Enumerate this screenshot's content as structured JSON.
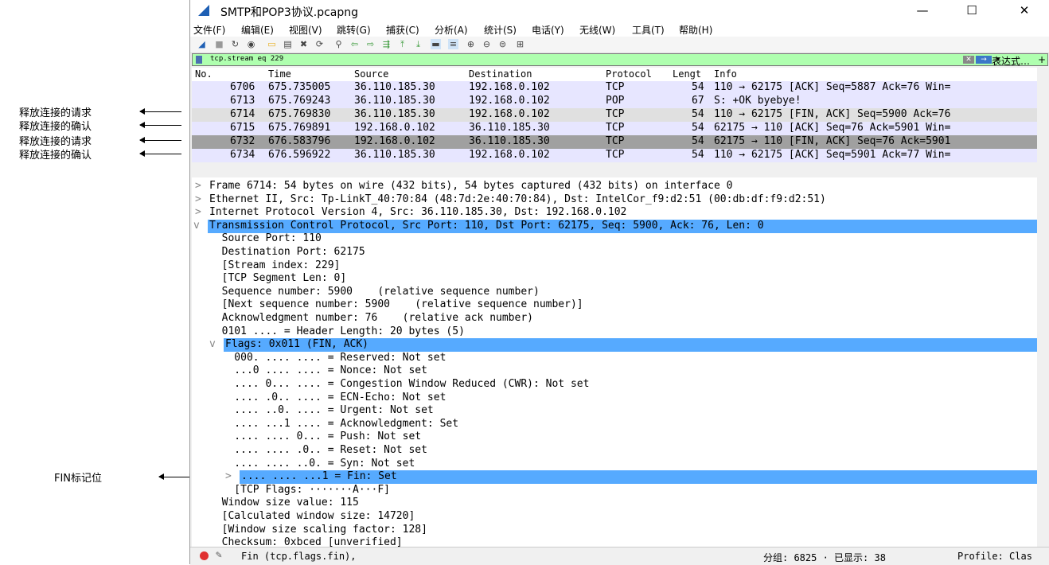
{
  "annotations": {
    "items": [
      "释放连接的请求",
      "释放连接的确认",
      "释放连接的请求",
      "释放连接的确认",
      "FIN标记位"
    ]
  },
  "window": {
    "title": "SMTP和POP3协议.pcapng",
    "minimize": "—",
    "maximize": "☐",
    "close": "✕"
  },
  "menu": [
    "文件(F)",
    "编辑(E)",
    "视图(V)",
    "跳转(G)",
    "捕获(C)",
    "分析(A)",
    "统计(S)",
    "电话(Y)",
    "无线(W)",
    "工具(T)",
    "帮助(H)"
  ],
  "toolbar": {
    "icons": [
      "shark-start-icon",
      "stop-icon",
      "restart-icon",
      "options-icon",
      "open-icon",
      "save-icon",
      "close-file-icon",
      "reload-icon",
      "find-icon",
      "back-icon",
      "forward-icon",
      "goto-icon",
      "first-icon",
      "last-icon",
      "autoscroll-icon",
      "colorize-icon",
      "zoom-in-icon",
      "zoom-out-icon",
      "zoom-reset-icon",
      "resize-columns-icon"
    ],
    "glyphs": [
      "◢",
      "■",
      "↻",
      "◉",
      "▭",
      "▤",
      "✖",
      "⟳",
      "⚲",
      "⇦",
      "⇨",
      "⇶",
      "⤒",
      "⤓",
      "▬",
      "≡",
      "⊕",
      "⊖",
      "⊜",
      "⊞"
    ]
  },
  "filter": {
    "value": "tcp.stream eq 229",
    "expression_label": "表达式…",
    "clear": "✕",
    "apply": "→",
    "dropdown": "▾",
    "add": "+"
  },
  "packet_list": {
    "headers": [
      "No.",
      "Time",
      "Source",
      "Destination",
      "Protocol",
      "Lengt",
      "Info"
    ],
    "rows": [
      {
        "no": "6706",
        "time": "675.735005",
        "src": "36.110.185.30",
        "dst": "192.168.0.102",
        "proto": "TCP",
        "len": "54",
        "info": "110 → 62175 [ACK] Seq=5887 Ack=76 Win=",
        "bg": "#e7e6ff"
      },
      {
        "no": "6713",
        "time": "675.769243",
        "src": "36.110.185.30",
        "dst": "192.168.0.102",
        "proto": "POP",
        "len": "67",
        "info": "S: +OK byebye!",
        "bg": "#e7e6ff"
      },
      {
        "no": "6714",
        "time": "675.769830",
        "src": "36.110.185.30",
        "dst": "192.168.0.102",
        "proto": "TCP",
        "len": "54",
        "info": "110 → 62175 [FIN, ACK] Seq=5900 Ack=76",
        "bg": "#e0e0e0"
      },
      {
        "no": "6715",
        "time": "675.769891",
        "src": "192.168.0.102",
        "dst": "36.110.185.30",
        "proto": "TCP",
        "len": "54",
        "info": "62175 → 110 [ACK] Seq=76 Ack=5901 Win=",
        "bg": "#e7e6ff"
      },
      {
        "no": "6732",
        "time": "676.583796",
        "src": "192.168.0.102",
        "dst": "36.110.185.30",
        "proto": "TCP",
        "len": "54",
        "info": "62175 → 110 [FIN, ACK] Seq=76 Ack=5901",
        "bg": "#a0a0a0"
      },
      {
        "no": "6734",
        "time": "676.596922",
        "src": "36.110.185.30",
        "dst": "192.168.0.102",
        "proto": "TCP",
        "len": "54",
        "info": "110 → 62175 [ACK] Seq=5901 Ack=77 Win=",
        "bg": "#e7e6ff"
      }
    ]
  },
  "detail": {
    "rows": [
      {
        "tw": ">",
        "text": "Frame 6714: 54 bytes on wire (432 bits), 54 bytes captured (432 bits) on interface 0",
        "sel": false
      },
      {
        "tw": ">",
        "text": "Ethernet II, Src: Tp-LinkT_40:70:84 (48:7d:2e:40:70:84), Dst: IntelCor_f9:d2:51 (00:db:df:f9:d2:51)",
        "sel": false
      },
      {
        "tw": ">",
        "text": "Internet Protocol Version 4, Src: 36.110.185.30, Dst: 192.168.0.102",
        "sel": false
      },
      {
        "tw": "v",
        "text": "Transmission Control Protocol, Src Port: 110, Dst Port: 62175, Seq: 5900, Ack: 76, Len: 0",
        "sel": true
      },
      {
        "tw": "",
        "text": "  Source Port: 110",
        "sel": false
      },
      {
        "tw": "",
        "text": "  Destination Port: 62175",
        "sel": false
      },
      {
        "tw": "",
        "text": "  [Stream index: 229]",
        "sel": false
      },
      {
        "tw": "",
        "text": "  [TCP Segment Len: 0]",
        "sel": false
      },
      {
        "tw": "",
        "text": "  Sequence number: 5900    (relative sequence number)",
        "sel": false
      },
      {
        "tw": "",
        "text": "  [Next sequence number: 5900    (relative sequence number)]",
        "sel": false
      },
      {
        "tw": "",
        "text": "  Acknowledgment number: 76    (relative ack number)",
        "sel": false
      },
      {
        "tw": "",
        "text": "  0101 .... = Header Length: 20 bytes (5)",
        "sel": false
      },
      {
        "tw": "v",
        "text": "  Flags: 0x011 (FIN, ACK)",
        "sel": true
      },
      {
        "tw": "",
        "text": "    000. .... .... = Reserved: Not set",
        "sel": false
      },
      {
        "tw": "",
        "text": "    ...0 .... .... = Nonce: Not set",
        "sel": false
      },
      {
        "tw": "",
        "text": "    .... 0... .... = Congestion Window Reduced (CWR): Not set",
        "sel": false
      },
      {
        "tw": "",
        "text": "    .... .0.. .... = ECN-Echo: Not set",
        "sel": false
      },
      {
        "tw": "",
        "text": "    .... ..0. .... = Urgent: Not set",
        "sel": false
      },
      {
        "tw": "",
        "text": "    .... ...1 .... = Acknowledgment: Set",
        "sel": false
      },
      {
        "tw": "",
        "text": "    .... .... 0... = Push: Not set",
        "sel": false
      },
      {
        "tw": "",
        "text": "    .... .... .0.. = Reset: Not set",
        "sel": false
      },
      {
        "tw": "",
        "text": "    .... .... ..0. = Syn: Not set",
        "sel": false
      },
      {
        "tw": ">",
        "text": "    .... .... ...1 = Fin: Set",
        "sel": true
      },
      {
        "tw": "",
        "text": "    [TCP Flags: ·······A···F]",
        "sel": false
      },
      {
        "tw": "",
        "text": "  Window size value: 115",
        "sel": false
      },
      {
        "tw": "",
        "text": "  [Calculated window size: 14720]",
        "sel": false
      },
      {
        "tw": "",
        "text": "  [Window size scaling factor: 128]",
        "sel": false
      },
      {
        "tw": "",
        "text": "  Checksum: 0xbced [unverified]",
        "sel": false
      }
    ]
  },
  "status": {
    "field": "Fin (tcp.flags.fin),",
    "packets": "分组: 6825 · 已显示: 38",
    "profile": "Profile: Clas"
  },
  "colors": {
    "selection": "#56aaff",
    "tcp_row": "#e7e6ff",
    "filter_ok": "#afffaf"
  }
}
